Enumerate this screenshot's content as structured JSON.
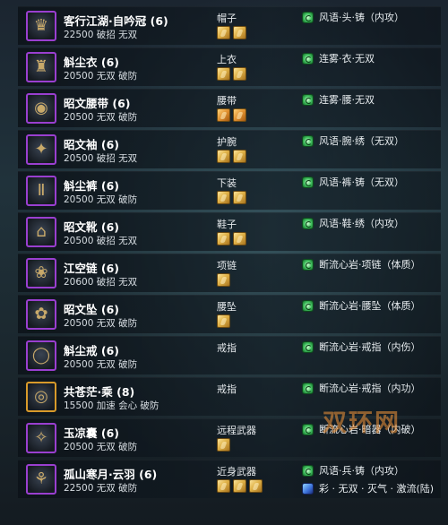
{
  "items": [
    {
      "name": "客行江湖·自吟冠 (6)",
      "stats": "22500 破招 无双",
      "slot": "帽子",
      "stones": 2,
      "stone_kind": "gold",
      "enhance": "风语·头·铸（内攻）",
      "icon": "hat-icon",
      "border": "purple"
    },
    {
      "name": "斛尘衣 (6)",
      "stats": "20500 无双 破防",
      "slot": "上衣",
      "stones": 2,
      "stone_kind": "gold",
      "enhance": "连雾·衣·无双",
      "icon": "robe-icon",
      "border": "purple"
    },
    {
      "name": "昭文腰带 (6)",
      "stats": "20500 无双 破防",
      "slot": "腰带",
      "stones": 2,
      "stone_kind": "orange",
      "enhance": "连雾·腰·无双",
      "icon": "belt-icon",
      "border": "purple"
    },
    {
      "name": "昭文袖 (6)",
      "stats": "20500 破招 无双",
      "slot": "护腕",
      "stones": 2,
      "stone_kind": "gold",
      "enhance": "风语·腕·绣（无双）",
      "icon": "bracer-icon",
      "border": "purple"
    },
    {
      "name": "斛尘裤 (6)",
      "stats": "20500 无双 破防",
      "slot": "下装",
      "stones": 2,
      "stone_kind": "gold",
      "enhance": "风语·裤·铸（无双）",
      "icon": "pants-icon",
      "border": "purple"
    },
    {
      "name": "昭文靴 (6)",
      "stats": "20500 破招 无双",
      "slot": "鞋子",
      "stones": 2,
      "stone_kind": "gold",
      "enhance": "风语·鞋·绣（内攻）",
      "icon": "boots-icon",
      "border": "purple"
    },
    {
      "name": "江空链 (6)",
      "stats": "20600 破招 无双",
      "slot": "项链",
      "stones": 1,
      "stone_kind": "gold",
      "enhance": "断流心岩·项链（体质）",
      "icon": "necklace-icon",
      "border": "purple"
    },
    {
      "name": "昭文坠 (6)",
      "stats": "20500 无双 破防",
      "slot": "腰坠",
      "stones": 1,
      "stone_kind": "gold",
      "enhance": "断流心岩·腰坠（体质）",
      "icon": "pendant-icon",
      "border": "purple"
    },
    {
      "name": "斛尘戒 (6)",
      "stats": "20500 无双 破防",
      "slot": "戒指",
      "stones": 0,
      "stone_kind": "gold",
      "enhance": "断流心岩·戒指（内伤）",
      "icon": "ring-icon",
      "border": "purple"
    },
    {
      "name": "共苍茫·乘 (8)",
      "stats": "15500 加速 会心 破防",
      "slot": "戒指",
      "stones": 0,
      "stone_kind": "gold",
      "enhance": "断流心岩·戒指（内功）",
      "icon": "ring-gold-icon",
      "border": "orange"
    },
    {
      "name": "玉凉囊 (6)",
      "stats": "20500 无双 破防",
      "slot": "远程武器",
      "stones": 1,
      "stone_kind": "gold",
      "enhance": "断流心岩·暗器（内破）",
      "icon": "pouch-icon",
      "border": "purple"
    },
    {
      "name": "孤山寒月·云羽 (6)",
      "stats": "22500 无双 破防",
      "slot": "近身武器",
      "stones": 3,
      "stone_kind": "gold",
      "enhance": "风语·兵·铸（内攻）",
      "enhance2": "彩 · 无双 · 灭气 · 激流(陆)",
      "icon": "fan-weapon-icon",
      "border": "purple"
    }
  ],
  "watermark": "双环网",
  "colors": {
    "purple_border": "#9a3fd0",
    "orange_border": "#d89a2a",
    "enhance_green": "#3cbd5a"
  }
}
